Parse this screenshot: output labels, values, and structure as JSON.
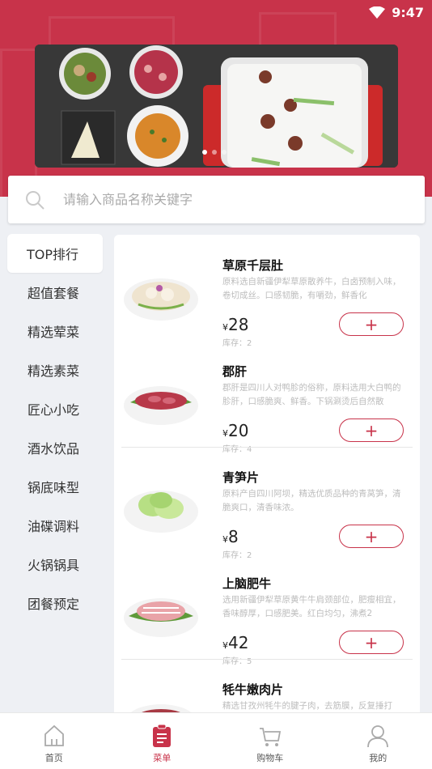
{
  "status": {
    "time": "9:47"
  },
  "search": {
    "placeholder": "请输入商品名称关键字"
  },
  "categories": [
    {
      "label": "TOP排行",
      "active": true
    },
    {
      "label": "超值套餐"
    },
    {
      "label": "精选荤菜"
    },
    {
      "label": "精选素菜"
    },
    {
      "label": "匠心小吃"
    },
    {
      "label": "酒水饮品"
    },
    {
      "label": "锅底味型"
    },
    {
      "label": "油碟调料"
    },
    {
      "label": "火锅锅具"
    },
    {
      "label": "团餐预定"
    }
  ],
  "products": [
    {
      "name": "草原千层肚",
      "desc": "原料选自新疆伊犁草原散养牛，白卤预制入味，卷切成丝。口感韧脆，有嚼劲，鲜香化",
      "price": "28",
      "stock": "库存：2"
    },
    {
      "name": "郡肝",
      "desc": "郡肝是四川人对鸭胗的俗称，原料选用大白鸭的胗肝，口感脆爽、鲜香。下锅涮烫后自然散",
      "price": "20",
      "stock": "库存：4"
    },
    {
      "name": "青笋片",
      "desc": "原料产自四川阿坝，精选优质品种的青莴笋，清脆爽口，清香味浓。",
      "price": "8",
      "stock": "库存：2"
    },
    {
      "name": "上脑肥牛",
      "desc": "选用新疆伊犁草原黄牛牛肩颈部位，肥瘦相宜，香味醇厚，口感肥美。红白均匀，沸煮2",
      "price": "42",
      "stock": "库存：5"
    },
    {
      "name": "牦牛嫩肉片",
      "desc": "精选甘孜州牦牛的腱子肉，去筋膜，反复捶打",
      "price": "",
      "stock": ""
    }
  ],
  "currency": "¥",
  "tabs": [
    {
      "label": "首页",
      "icon": "home-icon"
    },
    {
      "label": "菜单",
      "icon": "menu-icon",
      "active": true
    },
    {
      "label": "购物车",
      "icon": "cart-icon"
    },
    {
      "label": "我的",
      "icon": "user-icon"
    }
  ],
  "colors": {
    "brand": "#c8334a"
  }
}
